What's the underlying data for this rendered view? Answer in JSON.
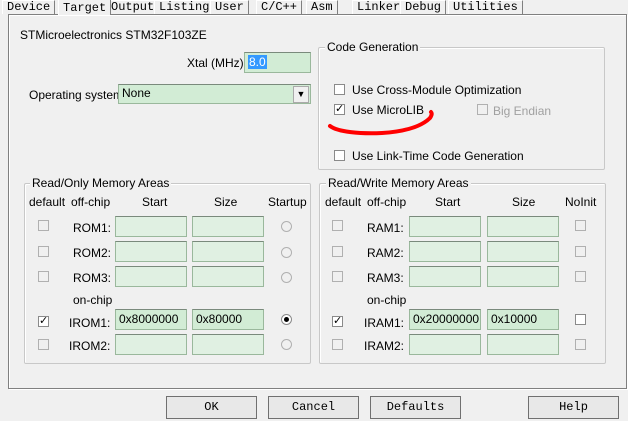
{
  "tabs": [
    "Device",
    "Target",
    "Output",
    "Listing",
    "User",
    "C/C++",
    "Asm",
    "Linker",
    "Debug",
    "Utilities"
  ],
  "device_name": "STMicroelectronics STM32F103ZE",
  "xtal": {
    "label": "Xtal (MHz):",
    "value": "8.0"
  },
  "os": {
    "label": "Operating system:",
    "value": "None"
  },
  "code_gen": {
    "title": "Code Generation",
    "cross_module": {
      "label": "Use Cross-Module Optimization",
      "checked": false
    },
    "microlib": {
      "label": "Use MicroLIB",
      "checked": true
    },
    "big_endian": {
      "label": "Big Endian",
      "checked": false,
      "enabled": false
    },
    "link_time": {
      "label": "Use Link-Time Code Generation",
      "checked": false
    }
  },
  "ro": {
    "title": "Read/Only Memory Areas",
    "headers": {
      "default": "default",
      "offchip": "off-chip",
      "start": "Start",
      "size": "Size",
      "startup": "Startup"
    },
    "onchip_label": "on-chip",
    "rows": [
      {
        "name": "ROM1:",
        "start": "",
        "size": "",
        "default": false,
        "startup": false
      },
      {
        "name": "ROM2:",
        "start": "",
        "size": "",
        "default": false,
        "startup": false
      },
      {
        "name": "ROM3:",
        "start": "",
        "size": "",
        "default": false,
        "startup": false
      },
      {
        "name": "IROM1:",
        "start": "0x8000000",
        "size": "0x80000",
        "default": true,
        "startup": true
      },
      {
        "name": "IROM2:",
        "start": "",
        "size": "",
        "default": false,
        "startup": false
      }
    ]
  },
  "rw": {
    "title": "Read/Write Memory Areas",
    "headers": {
      "default": "default",
      "offchip": "off-chip",
      "start": "Start",
      "size": "Size",
      "noinit": "NoInit"
    },
    "onchip_label": "on-chip",
    "rows": [
      {
        "name": "RAM1:",
        "start": "",
        "size": "",
        "default": false,
        "noinit": false
      },
      {
        "name": "RAM2:",
        "start": "",
        "size": "",
        "default": false,
        "noinit": false
      },
      {
        "name": "RAM3:",
        "start": "",
        "size": "",
        "default": false,
        "noinit": false
      },
      {
        "name": "IRAM1:",
        "start": "0x20000000",
        "size": "0x10000",
        "default": true,
        "noinit": false
      },
      {
        "name": "IRAM2:",
        "start": "",
        "size": "",
        "default": false,
        "noinit": false
      }
    ]
  },
  "buttons": {
    "ok": "OK",
    "cancel": "Cancel",
    "defaults": "Defaults",
    "help": "Help"
  },
  "colors": {
    "field": "#d2ecd5",
    "annotation": "#ff0000",
    "selection": "#3399ff"
  }
}
